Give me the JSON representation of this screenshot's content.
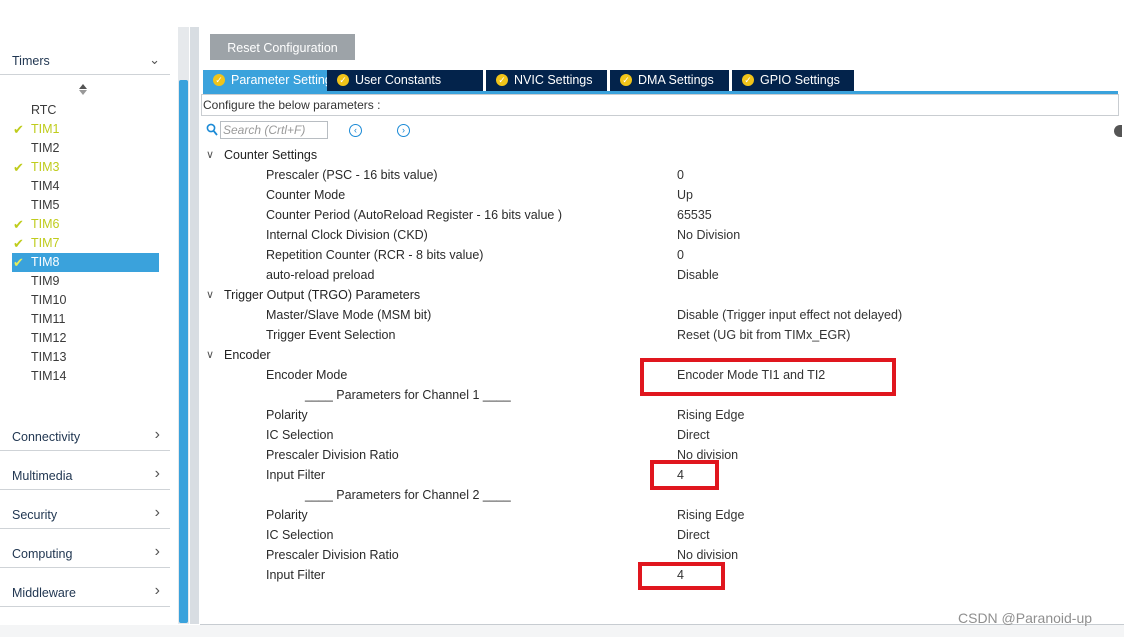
{
  "sidebar": {
    "timers_header": "Timers",
    "timers": [
      {
        "label": "RTC",
        "configured": false,
        "selected": false
      },
      {
        "label": "TIM1",
        "configured": true,
        "selected": false
      },
      {
        "label": "TIM2",
        "configured": false,
        "selected": false
      },
      {
        "label": "TIM3",
        "configured": true,
        "selected": false
      },
      {
        "label": "TIM4",
        "configured": false,
        "selected": false
      },
      {
        "label": "TIM5",
        "configured": false,
        "selected": false
      },
      {
        "label": "TIM6",
        "configured": true,
        "selected": false
      },
      {
        "label": "TIM7",
        "configured": true,
        "selected": false
      },
      {
        "label": "TIM8",
        "configured": true,
        "selected": true
      },
      {
        "label": "TIM9",
        "configured": false,
        "selected": false
      },
      {
        "label": "TIM10",
        "configured": false,
        "selected": false
      },
      {
        "label": "TIM11",
        "configured": false,
        "selected": false
      },
      {
        "label": "TIM12",
        "configured": false,
        "selected": false
      },
      {
        "label": "TIM13",
        "configured": false,
        "selected": false
      },
      {
        "label": "TIM14",
        "configured": false,
        "selected": false
      }
    ],
    "categories": [
      "Connectivity",
      "Multimedia",
      "Security",
      "Computing",
      "Middleware"
    ]
  },
  "toolbar": {
    "reset_label": "Reset Configuration"
  },
  "tabs": [
    {
      "label": "Parameter Settings",
      "active": true
    },
    {
      "label": "User Constants",
      "active": false
    },
    {
      "label": "NVIC Settings",
      "active": false
    },
    {
      "label": "DMA Settings",
      "active": false
    },
    {
      "label": "GPIO Settings",
      "active": false
    }
  ],
  "config": {
    "caption": "Configure the below parameters :",
    "search_placeholder": "Search (Crtl+F)"
  },
  "groups": [
    {
      "title": "Counter Settings",
      "rows": [
        {
          "name": "Prescaler (PSC - 16 bits value)",
          "value": "0"
        },
        {
          "name": "Counter Mode",
          "value": "Up"
        },
        {
          "name": "Counter Period (AutoReload Register - 16 bits value )",
          "value": "65535"
        },
        {
          "name": "Internal Clock Division (CKD)",
          "value": "No Division"
        },
        {
          "name": "Repetition Counter (RCR - 8 bits value)",
          "value": "0"
        },
        {
          "name": "auto-reload preload",
          "value": "Disable"
        }
      ]
    },
    {
      "title": "Trigger Output (TRGO) Parameters",
      "rows": [
        {
          "name": "Master/Slave Mode (MSM bit)",
          "value": "Disable (Trigger input effect not delayed)"
        },
        {
          "name": "Trigger Event Selection",
          "value": "Reset (UG bit from TIMx_EGR)"
        }
      ]
    },
    {
      "title": "Encoder",
      "rows": [
        {
          "name": "Encoder Mode",
          "value": "Encoder Mode TI1 and TI2"
        },
        {
          "subheader": "____ Parameters for Channel 1 ____"
        },
        {
          "name": "Polarity",
          "value": "Rising Edge"
        },
        {
          "name": "IC Selection",
          "value": "Direct"
        },
        {
          "name": "Prescaler Division Ratio",
          "value": "No division"
        },
        {
          "name": "Input Filter",
          "value": "4"
        },
        {
          "subheader": "____ Parameters for Channel 2 ____"
        },
        {
          "name": "Polarity",
          "value": "Rising Edge"
        },
        {
          "name": "IC Selection",
          "value": "Direct"
        },
        {
          "name": "Prescaler Division Ratio",
          "value": "No division"
        },
        {
          "name": "Input Filter",
          "value": "4"
        }
      ]
    }
  ],
  "watermark": "CSDN @Paranoid-up",
  "colors": {
    "accent": "#3aa2dc",
    "tab_dark": "#03234b",
    "configured": "#bfcc1c",
    "highlight": "#e0161e"
  }
}
